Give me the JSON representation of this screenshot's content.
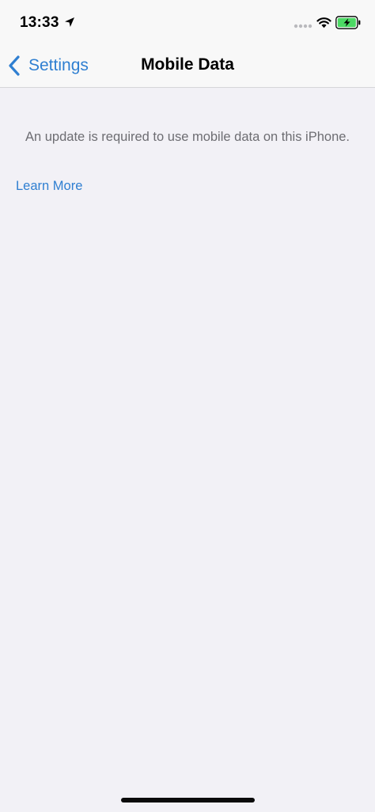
{
  "status_bar": {
    "time": "13:33",
    "location_icon": "location-arrow-icon",
    "signal_icon": "cellular-signal-icon",
    "wifi_icon": "wifi-icon",
    "battery_icon": "battery-charging-icon",
    "battery_color": "#4cd964"
  },
  "nav": {
    "back_label": "Settings",
    "back_icon": "chevron-left-icon",
    "title": "Mobile Data"
  },
  "content": {
    "message": "An update is required to use mobile data on this iPhone.",
    "learn_more": "Learn More"
  },
  "colors": {
    "accent": "#2f7fd1",
    "background": "#f2f1f6",
    "secondary_text": "#6d6d72"
  }
}
